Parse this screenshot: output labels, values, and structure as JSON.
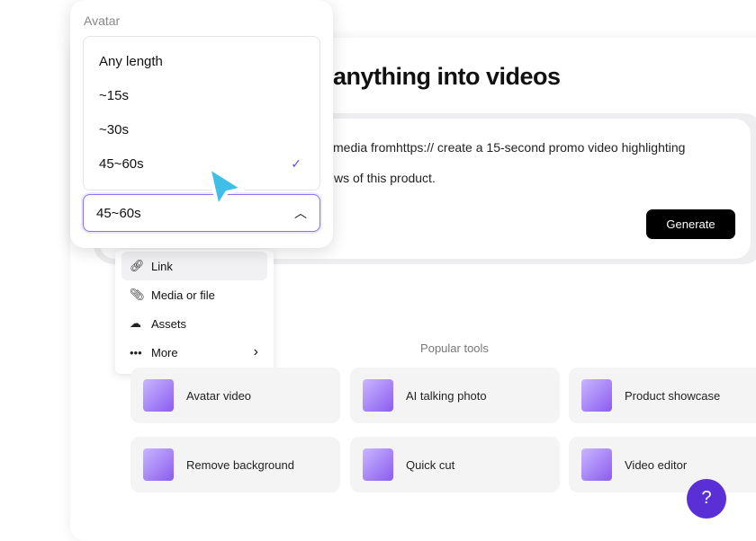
{
  "header": {
    "title": "anything into videos"
  },
  "prompt": {
    "line1": "media fromhttps:// create a 15-second promo video highlighting",
    "line2": "ws of this product.",
    "generate_label": "Generate"
  },
  "attach_menu": {
    "items": [
      {
        "label": "Link",
        "icon": "link-icon"
      },
      {
        "label": "Media or file",
        "icon": "paperclip-icon"
      },
      {
        "label": "Assets",
        "icon": "cloud-icon"
      },
      {
        "label": "More",
        "icon": "more-icon"
      }
    ]
  },
  "length_popover": {
    "label": "Avatar",
    "options": [
      "Any length",
      "~15s",
      "~30s",
      "45~60s"
    ],
    "selected": "45~60s",
    "accent": "#6b4ef0"
  },
  "popular": {
    "heading": "Popular tools",
    "tools": [
      "Avatar video",
      "AI talking photo",
      "Product showcase",
      "Remove background",
      "Quick cut",
      "Video editor"
    ]
  },
  "help": {
    "icon": "?"
  }
}
